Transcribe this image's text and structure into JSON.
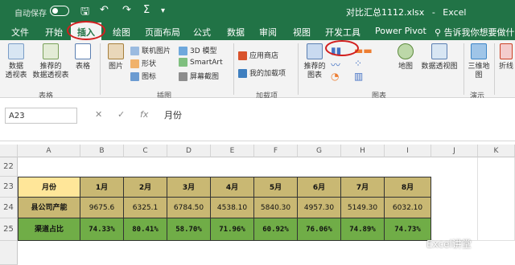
{
  "titlebar": {
    "autosave": "自动保存",
    "toggle": "关",
    "filename": "对比汇总1112.xlsx",
    "app": "Excel",
    "separator": "-",
    "save_icon": "save-icon",
    "undo_icon": "undo-icon",
    "redo_icon": "redo-icon",
    "sigma_icon": "sum-icon"
  },
  "tabs": [
    "文件",
    "开始",
    "插入",
    "绘图",
    "页面布局",
    "公式",
    "数据",
    "审阅",
    "视图",
    "开发工具",
    "Power Pivot"
  ],
  "tell_me": "告诉我你想要做什么",
  "ribbon": {
    "pivot_table": "数据\n透视表",
    "recommended_pivot": "推荐的\n数据透视表",
    "table": "表格",
    "picture": "图片",
    "online_picture": "联机图片",
    "shapes": "形状",
    "icons": "图标",
    "model3d": "3D 模型",
    "smartart": "SmartArt",
    "screenshot": "屏幕截图",
    "store": "应用商店",
    "my_addins": "我的加载项",
    "recommended_charts": "推荐的\n图表",
    "map": "地图",
    "pivot_chart": "数据透视图",
    "map3d": "三维地\n图",
    "sparkline": "折线",
    "groups": {
      "tables": "表格",
      "illustrations": "插图",
      "addins": "加载项",
      "charts": "图表",
      "tours": "演示"
    }
  },
  "formula": {
    "namebox": "A23",
    "cancel": "✕",
    "enter": "✓",
    "fx": "fx",
    "content": "月份"
  },
  "sheet": {
    "columns": [
      "A",
      "B",
      "C",
      "D",
      "E",
      "F",
      "G",
      "H",
      "I",
      "J",
      "K"
    ],
    "rows": [
      "22",
      "23",
      "24",
      "25"
    ],
    "header_row": [
      "月份",
      "1月",
      "2月",
      "3月",
      "4月",
      "5月",
      "6月",
      "7月",
      "8月"
    ],
    "row_output": [
      "县公司产能",
      "9675.6",
      "6325.1",
      "6784.50",
      "4538.10",
      "5840.30",
      "4957.30",
      "5149.30",
      "6032.10"
    ],
    "row_share": [
      "渠道占比",
      "74.33%",
      "80.41%",
      "58.70%",
      "71.96%",
      "60.92%",
      "76.06%",
      "74.89%",
      "74.73%"
    ]
  },
  "watermark": "Excel讲堂"
}
